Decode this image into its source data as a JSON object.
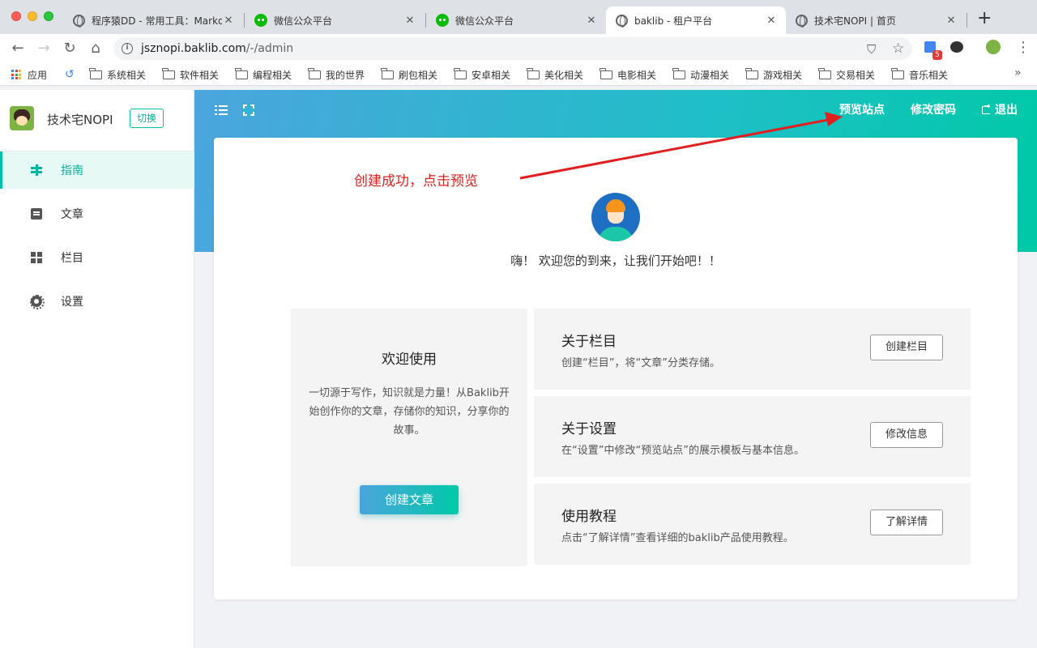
{
  "browser": {
    "tabs": [
      {
        "title": "程序猿DD - 常用工具：Markdo",
        "icon": "globe-icon"
      },
      {
        "title": "微信公众平台",
        "icon": "wechat-icon"
      },
      {
        "title": "微信公众平台",
        "icon": "wechat-icon"
      },
      {
        "title": "baklib - 租户平台",
        "icon": "globe-icon",
        "active": true
      },
      {
        "title": "技术宅NOPI | 首页",
        "icon": "globe-icon"
      }
    ],
    "new_tab": "+",
    "close_glyph": "✕",
    "url_host": "jsznopi.baklib.com",
    "url_path": "/-/admin",
    "ext_badge": "5",
    "bookmarks": [
      "应用",
      "系统相关",
      "软件相关",
      "编程相关",
      "我的世界",
      "刷包相关",
      "安卓相关",
      "美化相关",
      "电影相关",
      "动漫相关",
      "游戏相关",
      "交易相关",
      "音乐相关"
    ]
  },
  "sidebar": {
    "brand": "技术宅NOPI",
    "switch_label": "切换",
    "items": [
      {
        "label": "指南",
        "icon": "guide-icon",
        "active": true
      },
      {
        "label": "文章",
        "icon": "document-icon"
      },
      {
        "label": "栏目",
        "icon": "grid-icon"
      },
      {
        "label": "设置",
        "icon": "gear-icon"
      }
    ]
  },
  "header": {
    "preview": "预览站点",
    "change_password": "修改密码",
    "logout": "退出"
  },
  "annotation": "创建成功，点击预览",
  "main": {
    "welcome": "嗨！ 欢迎您的到来，让我们开始吧！！",
    "left": {
      "title": "欢迎使用",
      "desc": "一切源于写作，知识就是力量！从Baklib开始创作你的文章，存储你的知识，分享你的故事。",
      "button": "创建文章"
    },
    "rows": [
      {
        "title": "关于栏目",
        "desc": "创建“栏目”，将“文章”分类存储。",
        "button": "创建栏目"
      },
      {
        "title": "关于设置",
        "desc": "在“设置”中修改“预览站点”的展示模板与基本信息。",
        "button": "修改信息"
      },
      {
        "title": "使用教程",
        "desc": "点击“了解详情”查看详细的baklib产品使用教程。",
        "button": "了解详情"
      }
    ]
  },
  "colors": {
    "accent": "#00c0a8",
    "annotation": "#e02020",
    "gradient_start": "#4ba5dd",
    "gradient_end": "#00c9a7"
  }
}
